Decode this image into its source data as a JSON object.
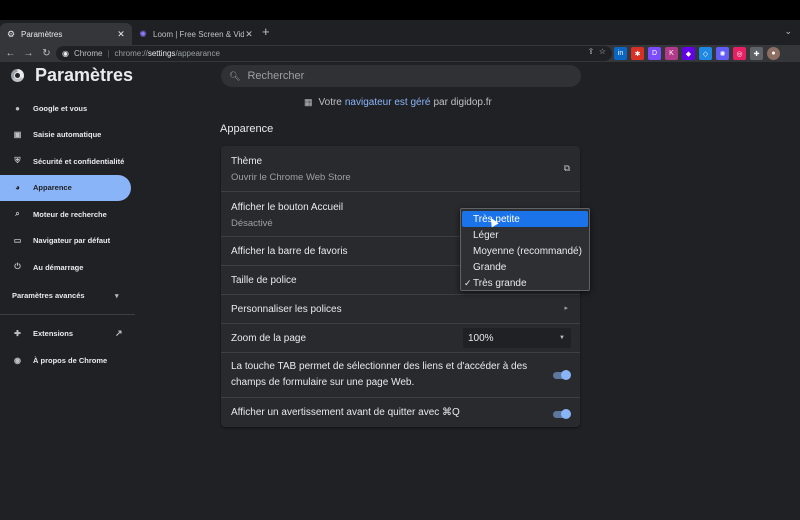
{
  "browser": {
    "tabs": [
      {
        "title": "Paramètres",
        "active": true
      },
      {
        "title": "Loom | Free Screen & Video Re",
        "active": false
      }
    ],
    "new_tab": "+",
    "omnibox": {
      "label": "Chrome",
      "url_scheme": "chrome://",
      "url_bold": "settings",
      "url_path": "/appearance"
    },
    "extensions": [
      {
        "name": "linkedin-ext",
        "text": "in",
        "color": "#0a66c2"
      },
      {
        "name": "red-ext",
        "text": "✱",
        "color": "#d93025"
      },
      {
        "name": "d-ext",
        "text": "D",
        "color": "#7c4dff"
      },
      {
        "name": "k-ext",
        "text": "K",
        "color": "#b23a8b"
      },
      {
        "name": "purple-ext",
        "text": "◆",
        "color": "#6200ea"
      },
      {
        "name": "blue-ext",
        "text": "◇",
        "color": "#1e88e5"
      },
      {
        "name": "loom-ext",
        "text": "✺",
        "color": "#625df5"
      },
      {
        "name": "pink-ext",
        "text": "◎",
        "color": "#e91e63"
      },
      {
        "name": "puzzle-ext",
        "text": "✚",
        "color": "#5f6368"
      },
      {
        "name": "profile-avatar",
        "text": "●",
        "color": "#8d6e63"
      }
    ]
  },
  "header": {
    "title": "Paramètres",
    "search_placeholder": "Rechercher"
  },
  "sidebar": {
    "items": [
      {
        "label": "Google et vous",
        "icon": "person-icon"
      },
      {
        "label": "Saisie automatique",
        "icon": "clipboard-icon"
      },
      {
        "label": "Sécurité et confidentialité",
        "icon": "shield-icon"
      },
      {
        "label": "Apparence",
        "icon": "palette-icon",
        "active": true
      },
      {
        "label": "Moteur de recherche",
        "icon": "search-icon"
      },
      {
        "label": "Navigateur par défaut",
        "icon": "browser-icon"
      },
      {
        "label": "Au démarrage",
        "icon": "power-icon"
      }
    ],
    "advanced": "Paramètres avancés",
    "extensions": "Extensions",
    "about": "À propos de Chrome"
  },
  "managed_banner": {
    "prefix": "Votre",
    "link": "navigateur est géré",
    "suffix": "par digidop.fr"
  },
  "appearance": {
    "section_title": "Apparence",
    "theme_label": "Thème",
    "theme_sub": "Ouvrir le Chrome Web Store",
    "home_label": "Afficher le bouton Accueil",
    "home_sub": "Désactivé",
    "bookmarks_label": "Afficher la barre de favoris",
    "font_size_label": "Taille de police",
    "fonts_label": "Personnaliser les polices",
    "zoom_label": "Zoom de la page",
    "zoom_value": "100%",
    "tab_key_label": "La touche TAB permet de sélectionner des liens et d'accéder à des champs de formulaire sur une page Web.",
    "tab_key_on": true,
    "quit_warning_label": "Afficher un avertissement avant de quitter avec ⌘Q",
    "quit_warning_on": true
  },
  "font_size_dropdown": {
    "options": [
      "Très petite",
      "Léger",
      "Moyenne (recommandé)",
      "Grande",
      "Très grande"
    ],
    "highlighted": "Très petite",
    "selected": "Très grande",
    "check": "✓"
  }
}
